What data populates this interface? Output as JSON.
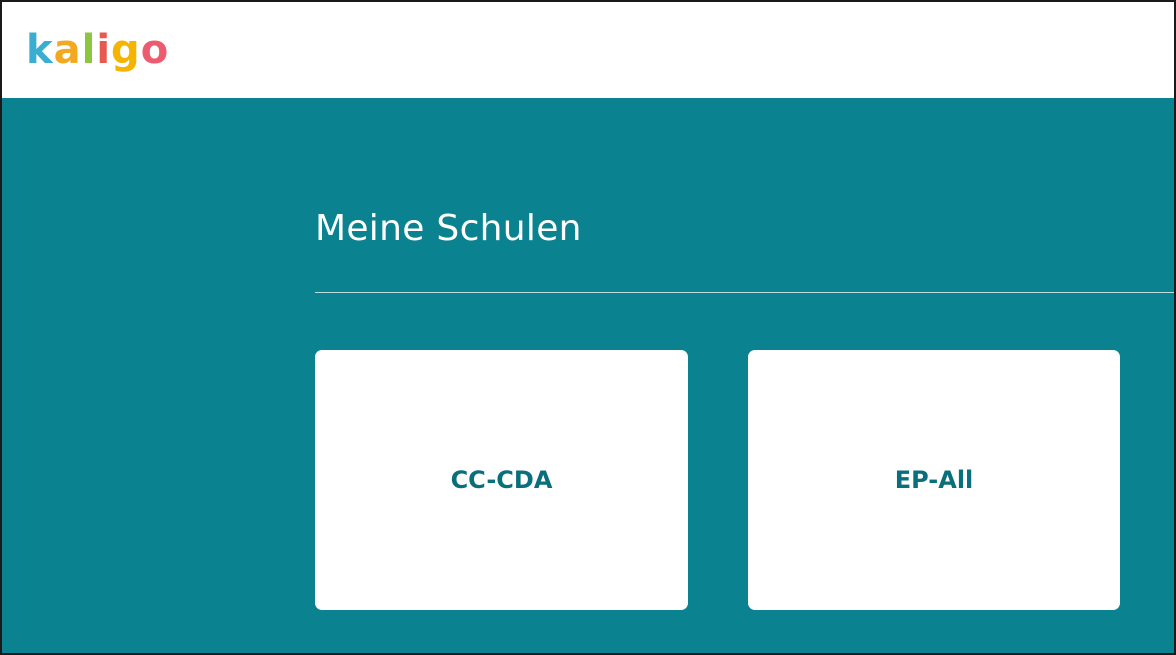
{
  "header": {
    "logo": {
      "letters": [
        {
          "char": "k",
          "color": "#3aaed0"
        },
        {
          "char": "a",
          "color": "#f2a91f"
        },
        {
          "char": "l",
          "color": "#8cc63f"
        },
        {
          "char": "i",
          "color": "#e8594f"
        },
        {
          "char": "g",
          "color": "#f5b400"
        },
        {
          "char": "o",
          "color": "#ec5b70"
        }
      ]
    }
  },
  "main": {
    "title": "Meine Schulen",
    "schools": [
      {
        "label": "CC-CDA"
      },
      {
        "label": "EP-All"
      }
    ]
  },
  "colors": {
    "header_bg": "#ffffff",
    "main_bg": "#0a828f",
    "card_bg": "#ffffff",
    "card_text": "#0a6f7c",
    "title_text": "#ffffff"
  }
}
